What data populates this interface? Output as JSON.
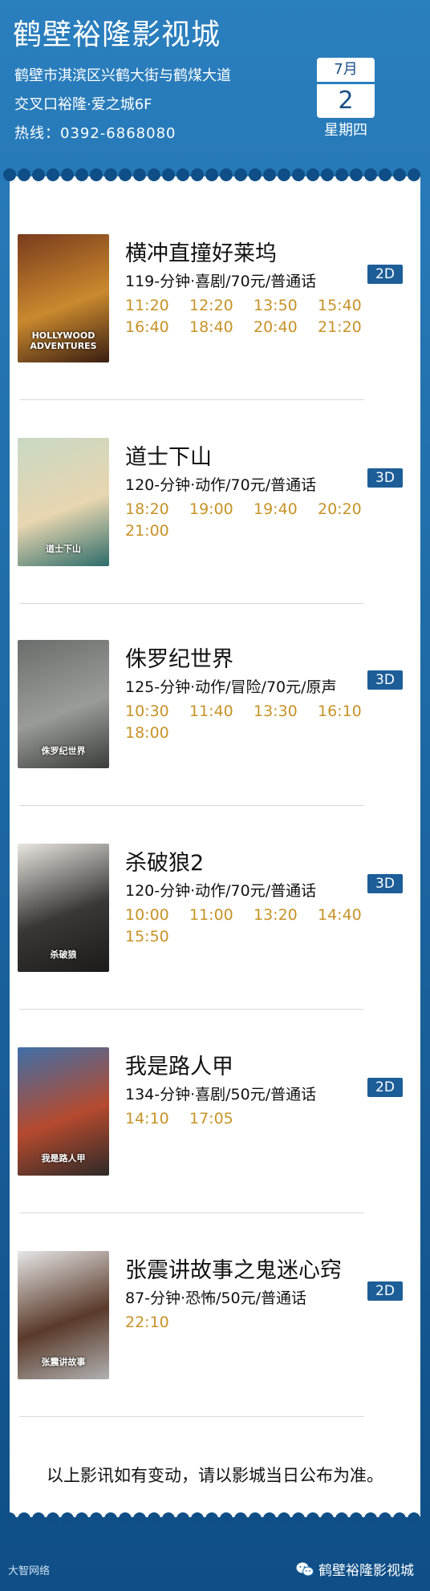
{
  "header": {
    "title": "鹤壁裕隆影视城",
    "address_line1": "鹤壁市淇滨区兴鹤大街与鹤煤大道",
    "address_line2": "交叉口裕隆·爱之城6F",
    "phone": "热线：0392-6868080",
    "date_month": "7月",
    "date_day": "2",
    "date_weekday": "星期四"
  },
  "movies": [
    {
      "title": "横冲直撞好莱坞",
      "info": "119-分钟·喜剧/70元/普通话",
      "format": "2D",
      "times": [
        "11:20",
        "12:20",
        "13:50",
        "15:40",
        "16:40",
        "18:40",
        "20:40",
        "21:20"
      ],
      "poster_text": "HOLLYWOOD ADVENTURES",
      "poster_colors": [
        "#7a3b1d",
        "#c9892e",
        "#3a1e12"
      ]
    },
    {
      "title": "道士下山",
      "info": "120-分钟·动作/70元/普通话",
      "format": "3D",
      "times": [
        "18:20",
        "19:00",
        "19:40",
        "20:20",
        "21:00"
      ],
      "poster_text": "道士下山",
      "poster_colors": [
        "#c8d8c4",
        "#e8d6b0",
        "#2d6c6a"
      ]
    },
    {
      "title": "侏罗纪世界",
      "info": "125-分钟·动作/冒险/70元/原声",
      "format": "3D",
      "times": [
        "10:30",
        "11:40",
        "13:30",
        "16:10",
        "18:00"
      ],
      "poster_text": "侏罗纪世界",
      "poster_colors": [
        "#6a6e6c",
        "#9a9c98",
        "#3a3c3a"
      ]
    },
    {
      "title": "杀破狼2",
      "info": "120-分钟·动作/70元/普通话",
      "format": "3D",
      "times": [
        "10:00",
        "11:00",
        "13:20",
        "14:40",
        "15:50"
      ],
      "poster_text": "杀破狼",
      "poster_colors": [
        "#e9e6e0",
        "#3a3836",
        "#1c1b1a"
      ]
    },
    {
      "title": "我是路人甲",
      "info": "134-分钟·喜剧/50元/普通话",
      "format": "2D",
      "times": [
        "14:10",
        "17:05"
      ],
      "poster_text": "我是路人甲",
      "poster_colors": [
        "#3f6fa8",
        "#b54a2e",
        "#2d2a28"
      ]
    },
    {
      "title": "张震讲故事之鬼迷心窍",
      "info": "87-分钟·恐怖/50元/普通话",
      "format": "2D",
      "times": [
        "22:10"
      ],
      "poster_text": "张震讲故事",
      "poster_colors": [
        "#e6e6e6",
        "#5a3a2a",
        "#b0b0b0"
      ]
    }
  ],
  "notice": "以上影讯如有变动，请以影城当日公布为准。",
  "footer": {
    "left_text": "大智网络",
    "wechat_name": "鹤壁裕隆影视城"
  },
  "colors": {
    "header_blue": "#1b6aa6",
    "badge_blue": "#1d5e98",
    "time_gold": "#c79227"
  }
}
